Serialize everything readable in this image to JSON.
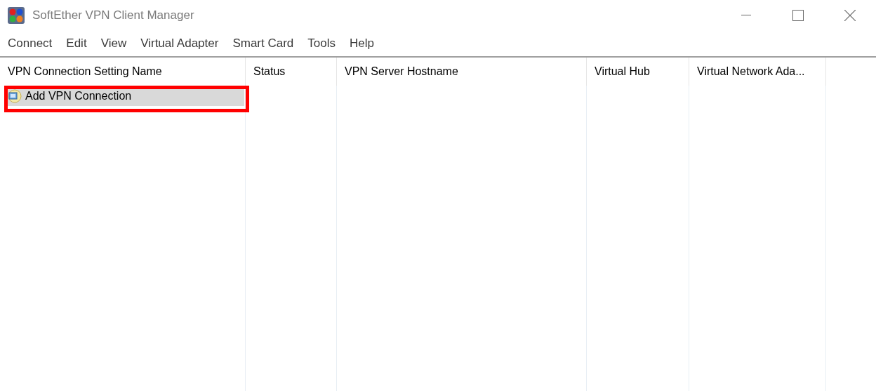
{
  "window": {
    "title": "SoftEther VPN Client Manager"
  },
  "menu": [
    "Connect",
    "Edit",
    "View",
    "Virtual Adapter",
    "Smart Card",
    "Tools",
    "Help"
  ],
  "table": {
    "columns": [
      "VPN Connection Setting Name",
      "Status",
      "VPN Server Hostname",
      "Virtual Hub",
      "Virtual Network Ada..."
    ],
    "rows": [
      {
        "cells": [
          "Add VPN Connection"
        ],
        "selected": true,
        "highlighted": true
      }
    ]
  }
}
